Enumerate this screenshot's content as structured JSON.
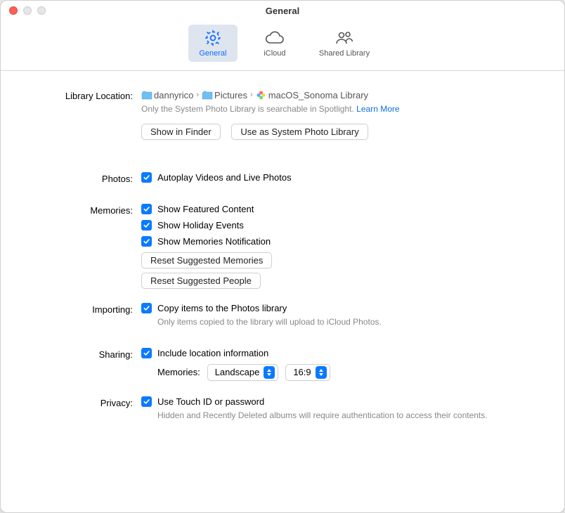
{
  "window": {
    "title": "General"
  },
  "toolbar": {
    "general": "General",
    "icloud": "iCloud",
    "shared": "Shared Library"
  },
  "library": {
    "label": "Library Location:",
    "path": [
      "dannyrico",
      "Pictures",
      "macOS_Sonoma Library"
    ],
    "note": "Only the System Photo Library is searchable in Spotlight.",
    "learn_more": "Learn More",
    "show_in_finder": "Show in Finder",
    "use_as_system": "Use as System Photo Library"
  },
  "photos": {
    "label": "Photos:",
    "autoplay": "Autoplay Videos and Live Photos"
  },
  "memories": {
    "label": "Memories:",
    "featured": "Show Featured Content",
    "holiday": "Show Holiday Events",
    "notification": "Show Memories Notification",
    "reset_memories": "Reset Suggested Memories",
    "reset_people": "Reset Suggested People"
  },
  "importing": {
    "label": "Importing:",
    "copy": "Copy items to the Photos library",
    "note": "Only items copied to the library will upload to iCloud Photos."
  },
  "sharing": {
    "label": "Sharing:",
    "location": "Include location information",
    "memories_label": "Memories:",
    "orientation": "Landscape",
    "ratio": "16:9"
  },
  "privacy": {
    "label": "Privacy:",
    "touchid": "Use Touch ID or password",
    "note": "Hidden and Recently Deleted albums will require authentication to access their contents."
  }
}
